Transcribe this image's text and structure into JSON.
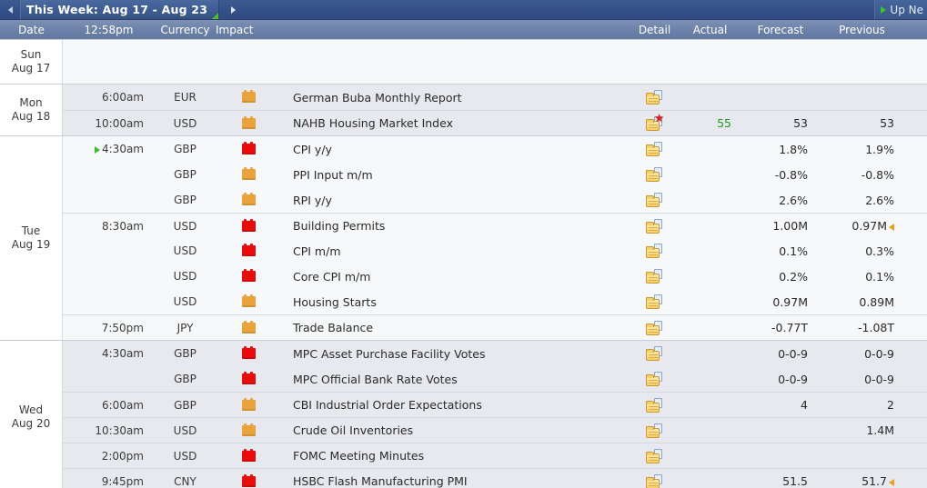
{
  "titlebar": {
    "prev_arrow": "prev",
    "next_arrow": "next",
    "week_label": "This Week: Aug 17 - Aug 23",
    "upnext_label": "Up Ne"
  },
  "columns": {
    "date": "Date",
    "time": "12:58pm",
    "currency": "Currency",
    "impact": "Impact",
    "event": "",
    "detail": "Detail",
    "actual": "Actual",
    "forecast": "Forecast",
    "previous": "Previous"
  },
  "days": [
    {
      "dow": "Sun",
      "date": "Aug 17",
      "shaded": false,
      "rows": []
    },
    {
      "dow": "Mon",
      "date": "Aug 18",
      "shaded": true,
      "rows": [
        {
          "time": "6:00am",
          "now": false,
          "currency": "EUR",
          "impact": "medium",
          "event": "German Buba Monthly Report",
          "detail_icon": "folder-icon",
          "detail_star": false,
          "actual": "",
          "actual_state": "plain",
          "forecast": "",
          "previous": "",
          "previous_revised": false,
          "new_row_group": true
        },
        {
          "time": "10:00am",
          "now": false,
          "currency": "USD",
          "impact": "medium",
          "event": "NAHB Housing Market Index",
          "detail_icon": "folder-icon",
          "detail_star": true,
          "actual": "55",
          "actual_state": "better",
          "forecast": "53",
          "previous": "53",
          "previous_revised": false,
          "new_row_group": true
        }
      ]
    },
    {
      "dow": "Tue",
      "date": "Aug 19",
      "shaded": false,
      "rows": [
        {
          "time": "4:30am",
          "now": true,
          "currency": "GBP",
          "impact": "high",
          "event": "CPI y/y",
          "detail_icon": "folder-icon",
          "detail_star": false,
          "actual": "",
          "actual_state": "plain",
          "forecast": "1.8%",
          "previous": "1.9%",
          "previous_revised": false,
          "new_row_group": true
        },
        {
          "time": "",
          "now": false,
          "currency": "GBP",
          "impact": "medium",
          "event": "PPI Input m/m",
          "detail_icon": "folder-icon",
          "detail_star": false,
          "actual": "",
          "actual_state": "plain",
          "forecast": "-0.8%",
          "previous": "-0.8%",
          "previous_revised": false,
          "new_row_group": false
        },
        {
          "time": "",
          "now": false,
          "currency": "GBP",
          "impact": "medium",
          "event": "RPI y/y",
          "detail_icon": "folder-icon",
          "detail_star": false,
          "actual": "",
          "actual_state": "plain",
          "forecast": "2.6%",
          "previous": "2.6%",
          "previous_revised": false,
          "new_row_group": false
        },
        {
          "time": "8:30am",
          "now": false,
          "currency": "USD",
          "impact": "high",
          "event": "Building Permits",
          "detail_icon": "folder-icon",
          "detail_star": false,
          "actual": "",
          "actual_state": "plain",
          "forecast": "1.00M",
          "previous": "0.97M",
          "previous_revised": true,
          "new_row_group": true
        },
        {
          "time": "",
          "now": false,
          "currency": "USD",
          "impact": "high",
          "event": "CPI m/m",
          "detail_icon": "folder-icon",
          "detail_star": false,
          "actual": "",
          "actual_state": "plain",
          "forecast": "0.1%",
          "previous": "0.3%",
          "previous_revised": false,
          "new_row_group": false
        },
        {
          "time": "",
          "now": false,
          "currency": "USD",
          "impact": "high",
          "event": "Core CPI m/m",
          "detail_icon": "folder-icon",
          "detail_star": false,
          "actual": "",
          "actual_state": "plain",
          "forecast": "0.2%",
          "previous": "0.1%",
          "previous_revised": false,
          "new_row_group": false
        },
        {
          "time": "",
          "now": false,
          "currency": "USD",
          "impact": "medium",
          "event": "Housing Starts",
          "detail_icon": "folder-icon",
          "detail_star": false,
          "actual": "",
          "actual_state": "plain",
          "forecast": "0.97M",
          "previous": "0.89M",
          "previous_revised": false,
          "new_row_group": false
        },
        {
          "time": "7:50pm",
          "now": false,
          "currency": "JPY",
          "impact": "medium",
          "event": "Trade Balance",
          "detail_icon": "folder-icon",
          "detail_star": false,
          "actual": "",
          "actual_state": "plain",
          "forecast": "-0.77T",
          "previous": "-1.08T",
          "previous_revised": false,
          "new_row_group": true
        }
      ]
    },
    {
      "dow": "Wed",
      "date": "Aug 20",
      "shaded": true,
      "rows": [
        {
          "time": "4:30am",
          "now": false,
          "currency": "GBP",
          "impact": "high",
          "event": "MPC Asset Purchase Facility Votes",
          "detail_icon": "folder-icon",
          "detail_star": false,
          "actual": "",
          "actual_state": "plain",
          "forecast": "0-0-9",
          "previous": "0-0-9",
          "previous_revised": false,
          "new_row_group": true
        },
        {
          "time": "",
          "now": false,
          "currency": "GBP",
          "impact": "high",
          "event": "MPC Official Bank Rate Votes",
          "detail_icon": "folder-icon",
          "detail_star": false,
          "actual": "",
          "actual_state": "plain",
          "forecast": "0-0-9",
          "previous": "0-0-9",
          "previous_revised": false,
          "new_row_group": false
        },
        {
          "time": "6:00am",
          "now": false,
          "currency": "GBP",
          "impact": "medium",
          "event": "CBI Industrial Order Expectations",
          "detail_icon": "folder-icon",
          "detail_star": false,
          "actual": "",
          "actual_state": "plain",
          "forecast": "4",
          "previous": "2",
          "previous_revised": false,
          "new_row_group": true
        },
        {
          "time": "10:30am",
          "now": false,
          "currency": "USD",
          "impact": "medium",
          "event": "Crude Oil Inventories",
          "detail_icon": "folder-icon",
          "detail_star": false,
          "actual": "",
          "actual_state": "plain",
          "forecast": "",
          "previous": "1.4M",
          "previous_revised": false,
          "new_row_group": true
        },
        {
          "time": "2:00pm",
          "now": false,
          "currency": "USD",
          "impact": "high",
          "event": "FOMC Meeting Minutes",
          "detail_icon": "folder-icon",
          "detail_star": false,
          "actual": "",
          "actual_state": "plain",
          "forecast": "",
          "previous": "",
          "previous_revised": false,
          "new_row_group": true
        },
        {
          "time": "9:45pm",
          "now": false,
          "currency": "CNY",
          "impact": "high",
          "event": "HSBC Flash Manufacturing PMI",
          "detail_icon": "folder-icon",
          "detail_star": false,
          "actual": "",
          "actual_state": "plain",
          "forecast": "51.5",
          "previous": "51.7",
          "previous_revised": true,
          "new_row_group": true
        }
      ]
    }
  ],
  "colors": {
    "titlebar": "#395584",
    "colheader": "#7085ad",
    "row_shaded": "#e7e9ee",
    "row_plain": "#f7f8fa",
    "impact_high": "#e80c0c",
    "impact_medium": "#e8a33d",
    "actual_better": "#1f9c1f",
    "now_marker": "#3fbb2f",
    "revised_marker": "#e8a020"
  }
}
